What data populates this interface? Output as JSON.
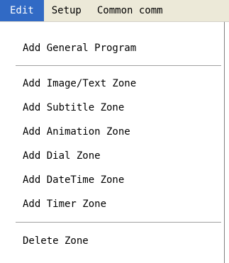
{
  "menubar": {
    "items": [
      {
        "label": "Edit"
      },
      {
        "label": "Setup"
      },
      {
        "label": "Common comm"
      }
    ]
  },
  "edit_menu": {
    "items": [
      {
        "label": "Add General Program"
      },
      {
        "label": "Add Image/Text Zone"
      },
      {
        "label": "Add Subtitle Zone"
      },
      {
        "label": "Add Animation Zone"
      },
      {
        "label": "Add Dial Zone"
      },
      {
        "label": "Add DateTime Zone"
      },
      {
        "label": "Add Timer Zone"
      },
      {
        "label": "Delete Zone"
      }
    ]
  },
  "colors": {
    "menubar_bg": "#ece9d8",
    "active_highlight": "#316ac5"
  }
}
